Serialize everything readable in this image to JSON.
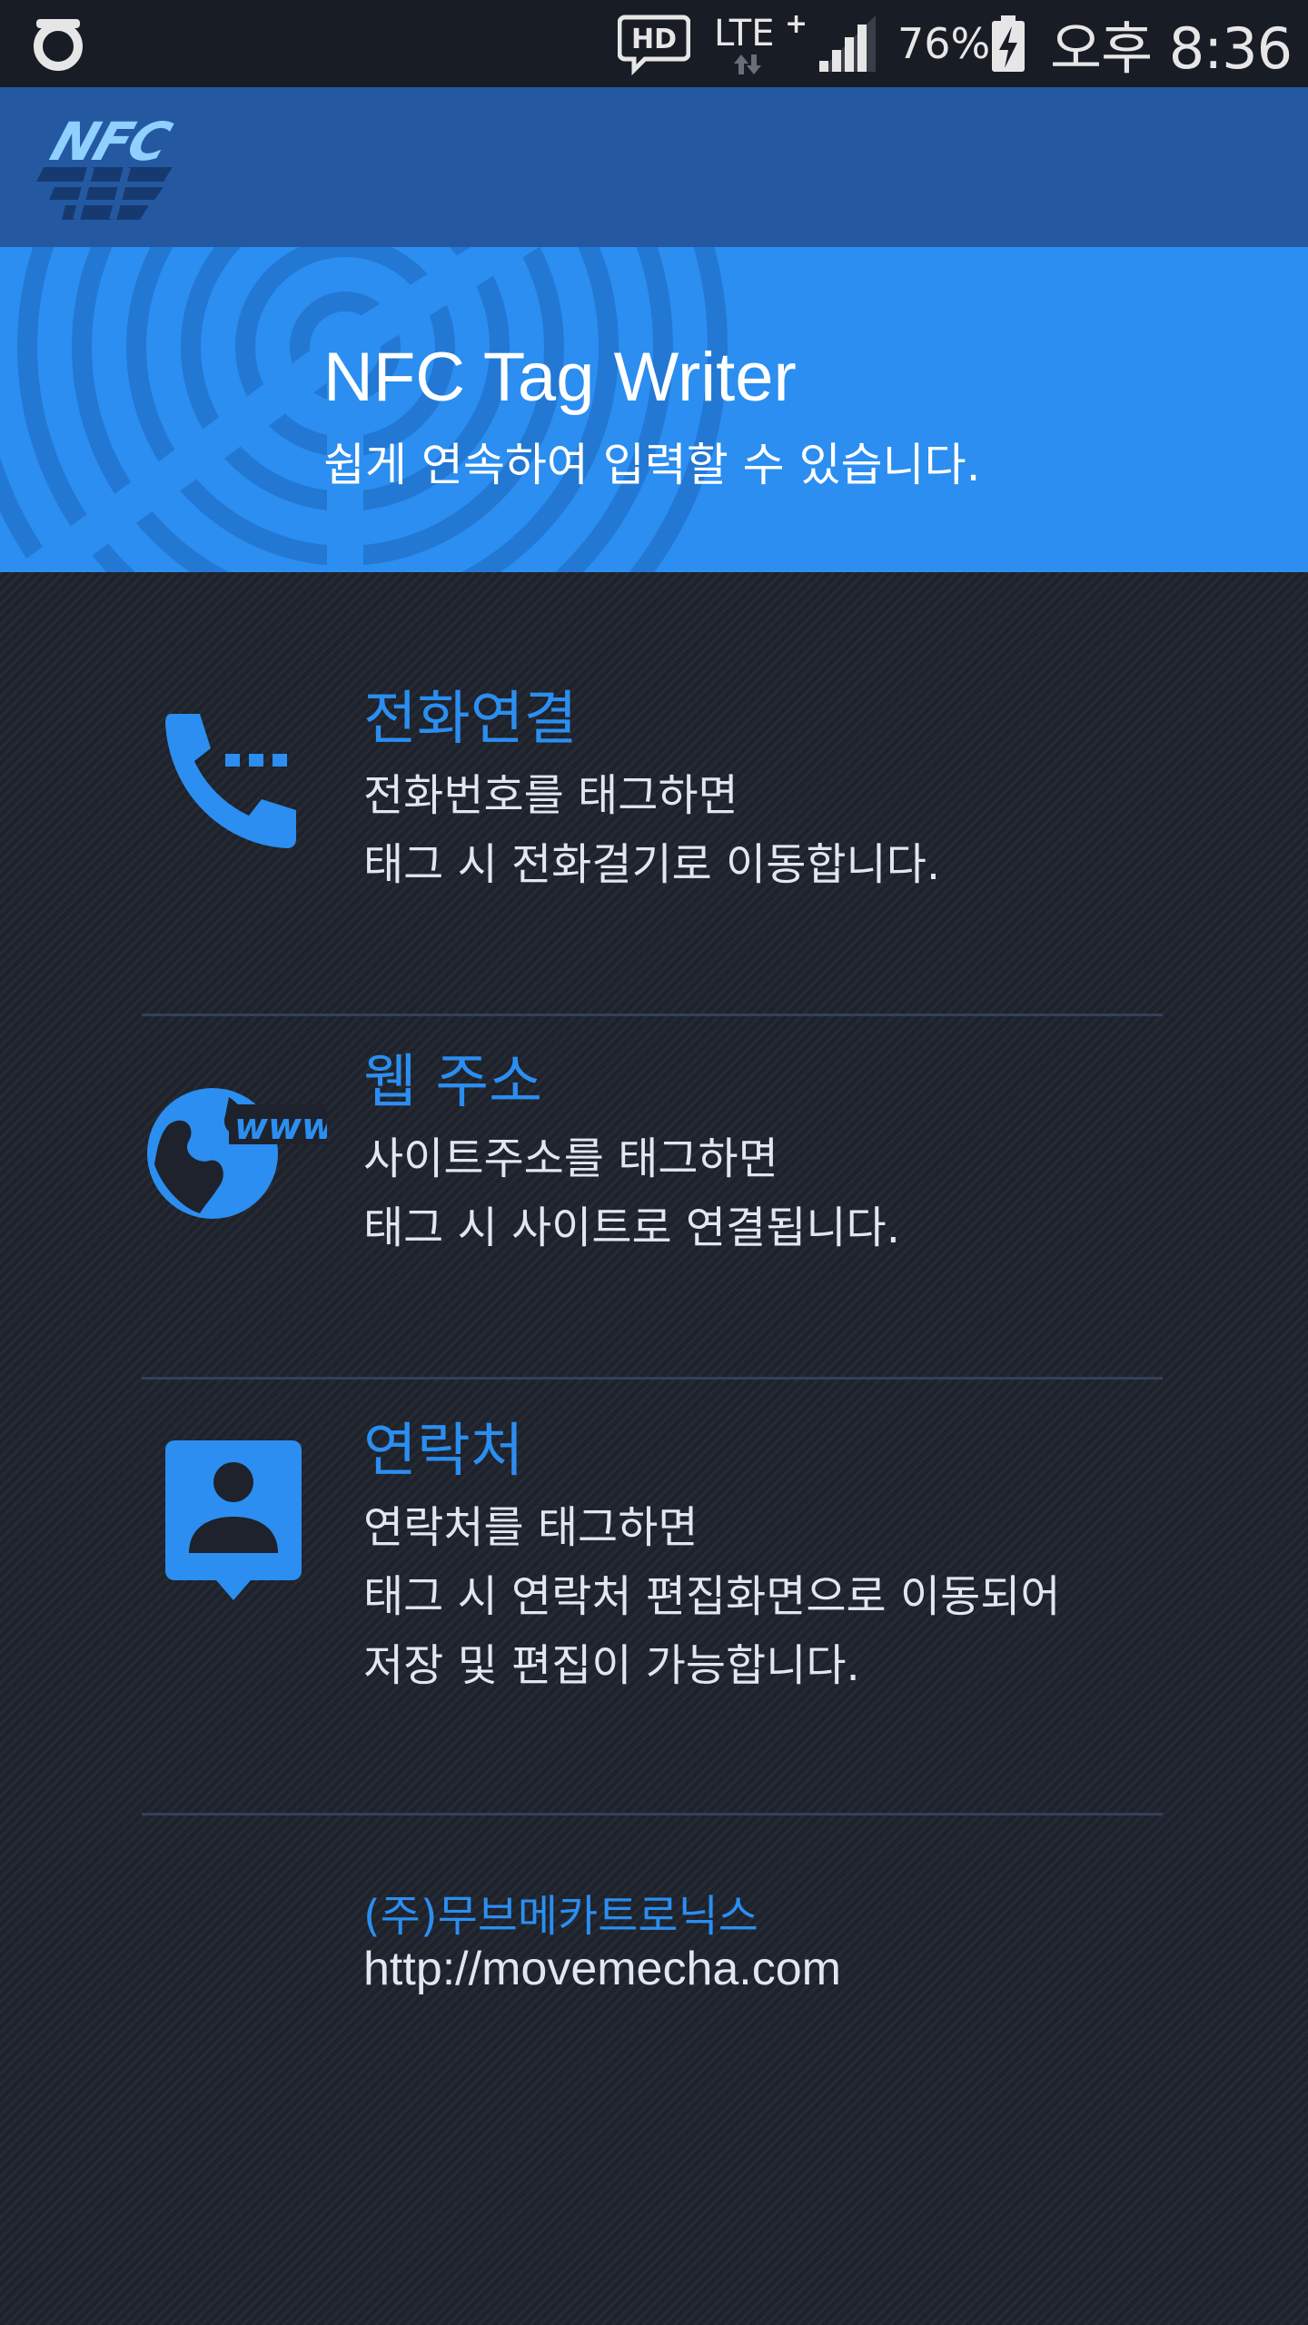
{
  "status_bar": {
    "carrier_icon": "olleh-carrier-icon",
    "hd": "HD",
    "network": "LTE",
    "network_plus": "+",
    "battery": "76%",
    "time": "오후 8:36"
  },
  "header": {
    "logo_text": "NFC"
  },
  "banner": {
    "title": "NFC Tag Writer",
    "subtitle": "쉽게 연속하여 입력할 수 있습니다."
  },
  "menu": {
    "items": [
      {
        "icon": "phone-dialing-icon",
        "title": "전화연결",
        "line1": "전화번호를 태그하면",
        "line2": "태그 시 전화걸기로 이동합니다."
      },
      {
        "icon": "globe-www-icon",
        "title": "웹 주소",
        "line1": "사이트주소를 태그하면",
        "line2": "태그 시 사이트로 연결됩니다."
      },
      {
        "icon": "contact-card-icon",
        "title": "연락처",
        "line1": "연락처를 태그하면",
        "line2": "태그 시 연락처 편집화면으로 이동되어",
        "line3": "저장 및 편집이 가능합니다."
      }
    ]
  },
  "footer": {
    "company": "(주)무브메카트로닉스",
    "url": "http://movemecha.com"
  },
  "colors": {
    "status_bar": "#181c24",
    "header": "#2459a2",
    "banner": "#2b8ef0",
    "accent": "#2b8ef0",
    "background": "#1e222c",
    "text": "#e2e6f0"
  }
}
